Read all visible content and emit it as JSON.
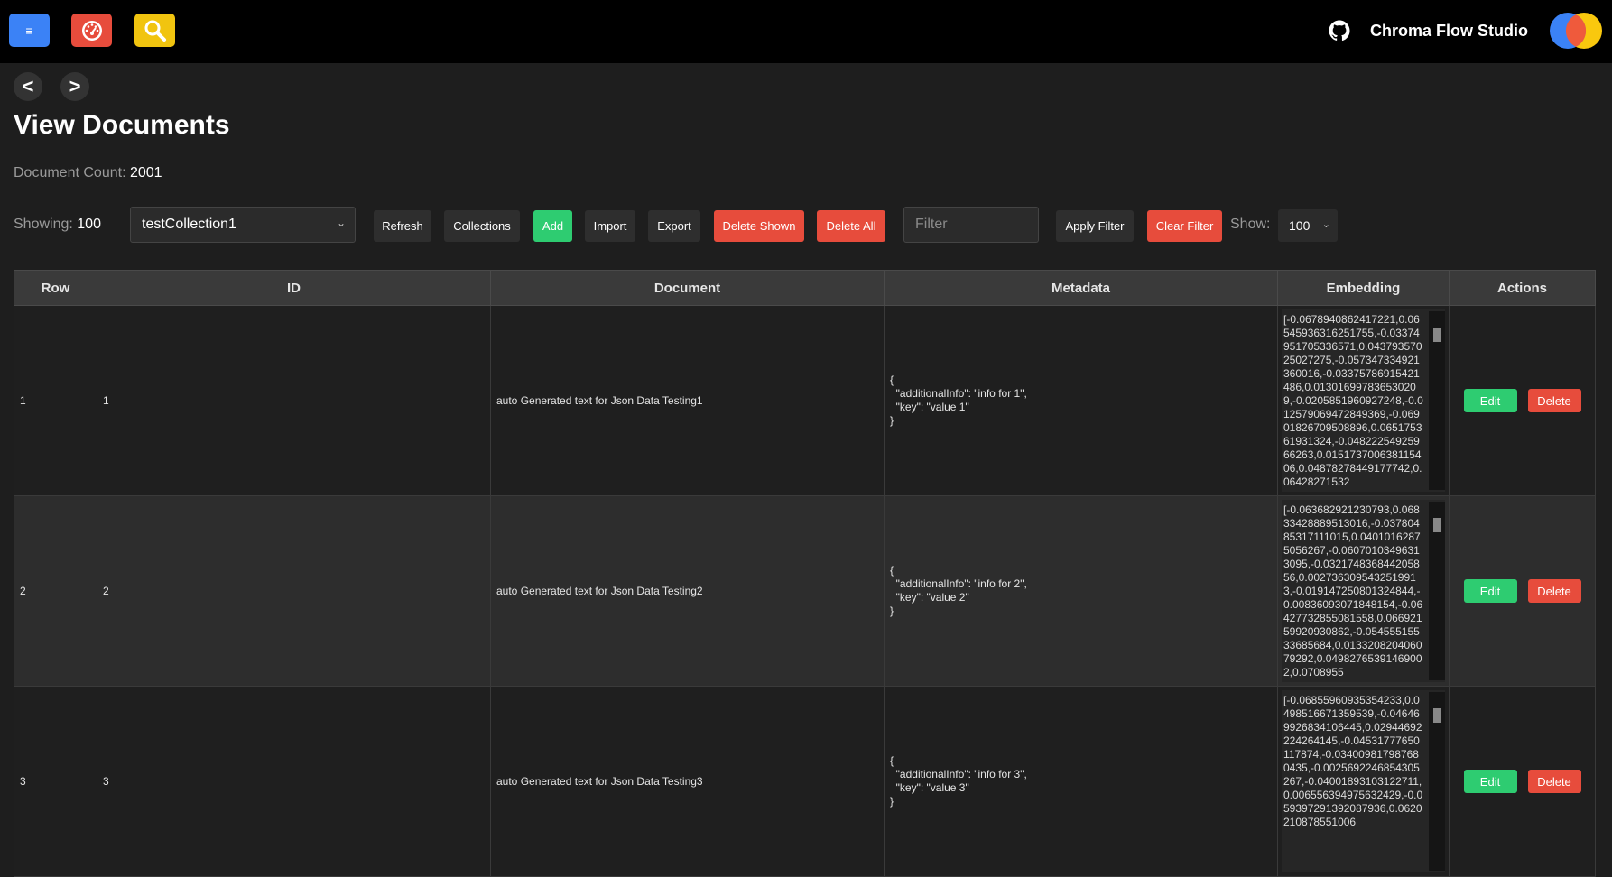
{
  "topbar": {
    "menu_label": "≡",
    "brand": "Chroma Flow Studio",
    "colors": {
      "menu": "#3b82f6",
      "dashboard": "#e74c3c",
      "search": "#f1c40f"
    }
  },
  "nav": {
    "back": "<",
    "forward": ">"
  },
  "page": {
    "title": "View Documents",
    "count_label": "Document Count:",
    "count_value": "2001"
  },
  "toolbar": {
    "showing_label": "Showing:",
    "showing_value": "100",
    "collection": "testCollection1",
    "refresh": "Refresh",
    "collections": "Collections",
    "add": "Add",
    "import": "Import",
    "export": "Export",
    "delete_shown": "Delete Shown",
    "delete_all": "Delete All",
    "filter_placeholder": "Filter",
    "apply_filter": "Apply Filter",
    "clear_filter": "Clear Filter",
    "show_label": "Show:",
    "show_value": "100"
  },
  "table": {
    "headers": [
      "Row",
      "ID",
      "Document",
      "Metadata",
      "Embedding",
      "Actions"
    ],
    "edit_label": "Edit",
    "delete_label": "Delete",
    "rows": [
      {
        "row": "1",
        "id": "1",
        "document": "auto Generated text for Json Data Testing1",
        "metadata": "{\n  \"additionalInfo\": \"info for 1\",\n  \"key\": \"value 1\"\n}",
        "embedding": "[-0.0678940862417221,0.06545936316251755,-0.03374951705336571,0.04379357025027275,-0.057347334921360016,-0.03375786915421486,0.013016997836530209,-0.0205851960927248,-0.012579069472849369,-0.06901826709508896,0.065175361931324,-0.04822254925966263,0.015173700638115406,0.04878278449177742,0.06428271532"
      },
      {
        "row": "2",
        "id": "2",
        "document": "auto Generated text for Json Data Testing2",
        "metadata": "{\n  \"additionalInfo\": \"info for 2\",\n  \"key\": \"value 2\"\n}",
        "embedding": "[-0.063682921230793,0.06833428889513016,-0.03780485317111015,0.04010162875056267,-0.06070103496313095,-0.032174836844205856,0.0027363095432519913,-0.019147250801324844,-0.00836093071848154,-0.06427732855081558,0.06692159920930862,-0.05455515533685684,0.013320820406079292,0.04982765391469002,0.0708955"
      },
      {
        "row": "3",
        "id": "3",
        "document": "auto Generated text for Json Data Testing3",
        "metadata": "{\n  \"additionalInfo\": \"info for 3\",\n  \"key\": \"value 3\"\n}",
        "embedding": "[-0.06855960935354233,0.0498516671359539,-0.046469926834106445,0.02944692224264145,-0.04531777650117874,-0.034009817987680435,-0.0025692246854305267,-0.04001893103122711,0.006556394975632429,-0.059397291392087936,0.0620210878551006"
      }
    ]
  }
}
